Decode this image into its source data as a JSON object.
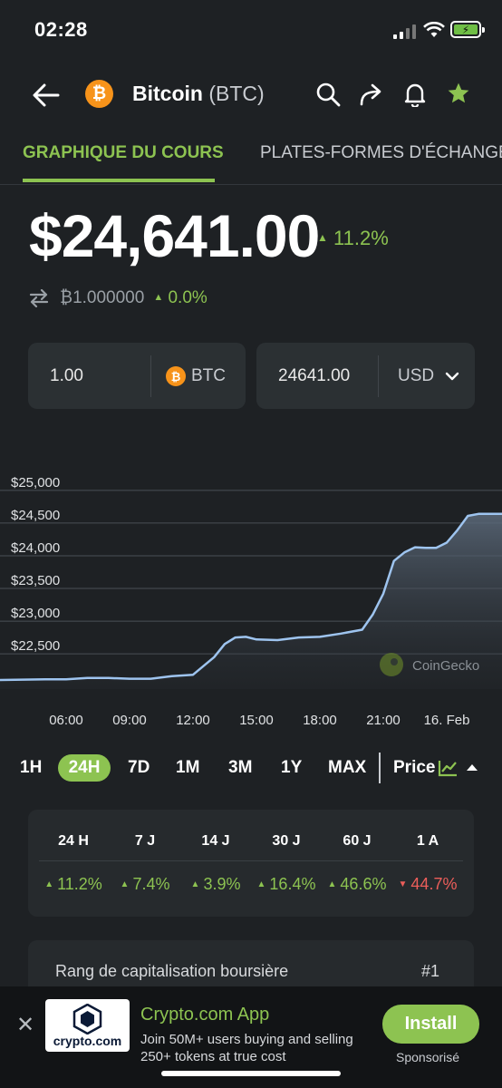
{
  "status_bar": {
    "time": "02:28"
  },
  "header": {
    "coin_symbol_glyph": "₿",
    "coin_name": "Bitcoin",
    "coin_ticker": "(BTC)"
  },
  "tabs": [
    {
      "label": "GRAPHIQUE DU COURS",
      "active": true
    },
    {
      "label": "PLATES-FORMES D'ÉCHANGE",
      "active": false
    }
  ],
  "price": {
    "value": "$24,641.00",
    "change": "11.2%",
    "btc_value": "₿1.000000",
    "btc_change": "0.0%"
  },
  "converter": {
    "left_value": "1.00",
    "left_unit": "BTC",
    "right_value": "24641.00",
    "right_unit": "USD"
  },
  "chart_data": {
    "type": "area",
    "ytick_labels": [
      "$25,000",
      "$24,500",
      "$24,000",
      "$23,500",
      "$23,000",
      "$22,500"
    ],
    "xtick_labels": [
      "06:00",
      "09:00",
      "12:00",
      "15:00",
      "18:00",
      "21:00",
      "16. Feb"
    ],
    "ylim": [
      22100,
      25150
    ],
    "grid": true,
    "watermark": "CoinGecko",
    "x": [
      3.0,
      5.0,
      6.0,
      7.0,
      8.0,
      9.0,
      10.0,
      11.0,
      12.0,
      13.0,
      13.5,
      14.0,
      14.5,
      15.0,
      16.0,
      17.0,
      18.0,
      19.0,
      20.0,
      20.5,
      21.0,
      21.5,
      22.0,
      22.5,
      23.0,
      23.5,
      24.0,
      24.5,
      25.0,
      25.5
    ],
    "values": [
      22100,
      22110,
      22110,
      22130,
      22130,
      22120,
      22120,
      22160,
      22180,
      22450,
      22650,
      22750,
      22760,
      22720,
      22710,
      22750,
      22760,
      22810,
      22870,
      23100,
      23420,
      23920,
      24050,
      24130,
      24120,
      24120,
      24200,
      24390,
      24610,
      24640
    ]
  },
  "ranges": {
    "items": [
      "1H",
      "24H",
      "7D",
      "1M",
      "3M",
      "1Y",
      "MAX"
    ],
    "active": "24H",
    "mode_label": "Price"
  },
  "performance": {
    "headers": [
      "24 H",
      "7 J",
      "14 J",
      "30 J",
      "60 J",
      "1 A"
    ],
    "values": [
      {
        "text": "11.2%",
        "dir": "up"
      },
      {
        "text": "7.4%",
        "dir": "up"
      },
      {
        "text": "3.9%",
        "dir": "up"
      },
      {
        "text": "16.4%",
        "dir": "up"
      },
      {
        "text": "46.6%",
        "dir": "up"
      },
      {
        "text": "44.7%",
        "dir": "down"
      }
    ]
  },
  "market_cap": {
    "label": "Rang de capitalisation boursière",
    "value": "#1"
  },
  "ad": {
    "logo_text": "crypto.com",
    "title": "Crypto.com App",
    "description": "Join 50M+ users buying and selling 250+ tokens at true cost",
    "button": "Install",
    "sponsored": "Sponsorisé"
  },
  "colors": {
    "accent": "#8dc351",
    "negative": "#ec5e5a",
    "background": "#1e2124",
    "line": "#9ec4ef"
  }
}
